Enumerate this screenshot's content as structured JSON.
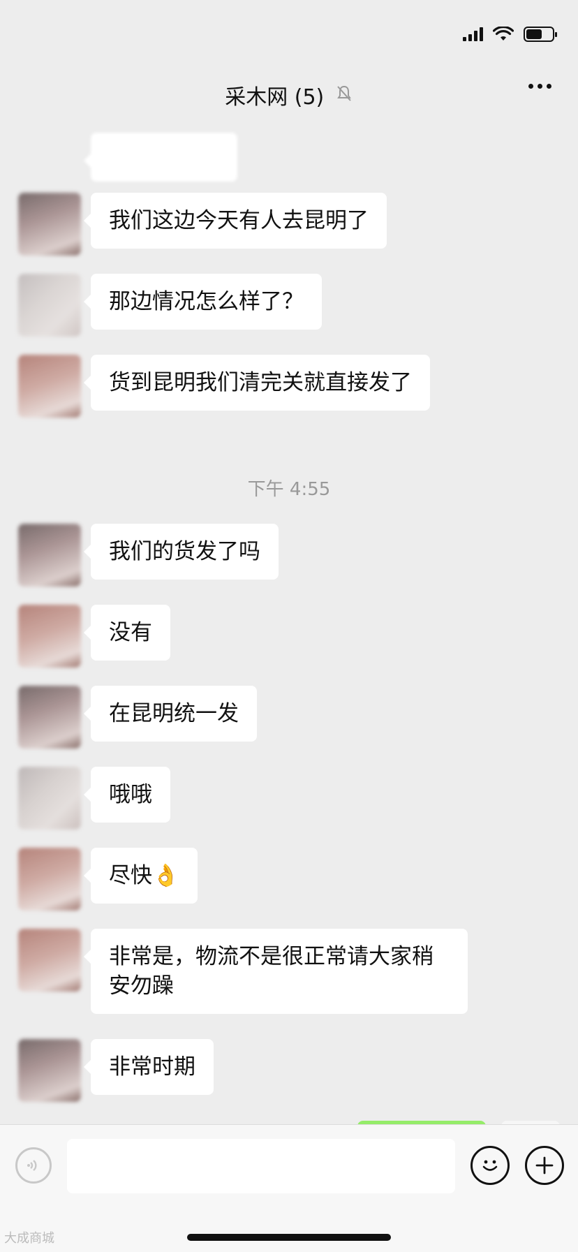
{
  "header": {
    "title": "采木网",
    "member_count": "(5)"
  },
  "messages_top": [
    {
      "text": "我们这边今天有人去昆明了"
    },
    {
      "text": "那边情况怎么样了？"
    },
    {
      "text": "货到昆明我们清完关就直接发了"
    }
  ],
  "timestamp": "下午 4:55",
  "messages_bottom": [
    {
      "text": "我们的货发了吗"
    },
    {
      "text": "没有"
    },
    {
      "text": "在昆明统一发"
    },
    {
      "text": "哦哦"
    },
    {
      "text": "尽快👌"
    },
    {
      "text": "非常是，物流不是很正常请大家稍安勿躁"
    },
    {
      "text": "非常时期"
    }
  ],
  "watermark": "大成商城",
  "colors": {
    "background": "#ededed",
    "bubble_incoming": "#ffffff",
    "bubble_outgoing": "#95ec69",
    "timestamp": "#999999"
  },
  "icons": {
    "mute": "bell-slash-icon",
    "more": "more-dots-icon",
    "voice": "voice-icon",
    "emoji": "emoji-icon",
    "plus": "plus-icon"
  }
}
